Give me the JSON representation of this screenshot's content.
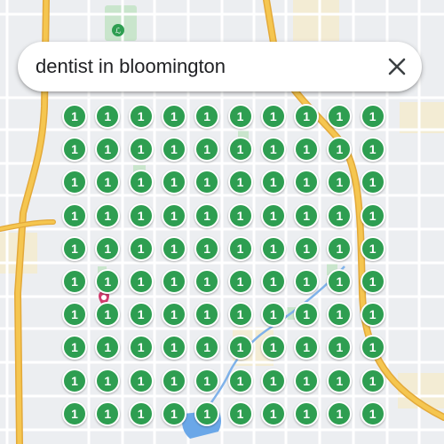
{
  "search": {
    "query": "dentist in bloomington",
    "close_icon": "close-icon"
  },
  "map": {
    "colors": {
      "background": "#eceef1",
      "street": "#ffffff",
      "highway": "#f5c650",
      "highway_edge": "#e3a93a",
      "water": "#6aa7e8",
      "stream": "#7fb2ea",
      "park": "#c9e5cc",
      "commercial": "#f3ecd4",
      "marker": "#2e9e51",
      "pin": "#d23c6e"
    },
    "marker_label": "1",
    "grid": {
      "rows": 10,
      "cols": 10
    },
    "poi_icons": [
      "park-icon",
      "dentist-pin-icon",
      "dentist-pin-icon"
    ]
  }
}
